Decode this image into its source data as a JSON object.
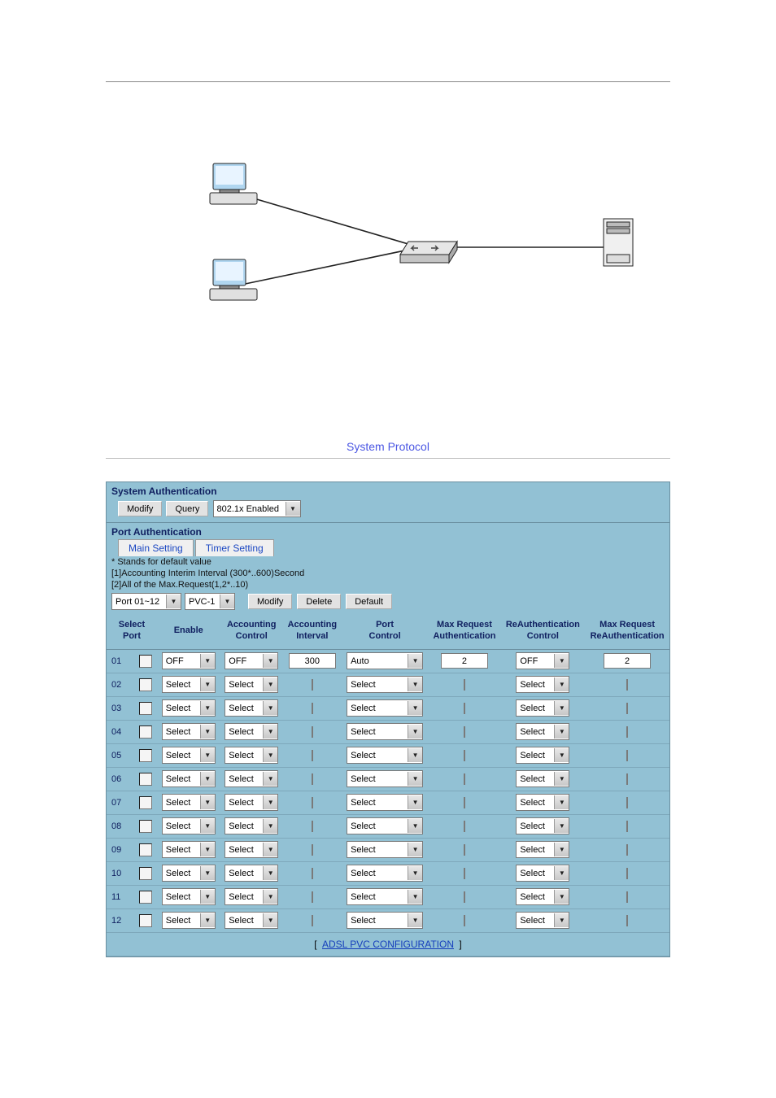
{
  "sectionTitle": "System Protocol",
  "sysAuth": {
    "header": "System Authentication",
    "modify": "Modify",
    "query": "Query",
    "state": "802.1x Enabled"
  },
  "portAuth": {
    "header": "Port Authentication",
    "tab1": "Main Setting",
    "tab2": "Timer Setting",
    "hint1": "* Stands for default value",
    "hint2": "[1]Accounting Interim Interval (300*..600)Second",
    "hint3": "[2]All of the Max.Request(1,2*..10)",
    "portRange": "Port 01~12",
    "pvc": "PVC-1",
    "modify": "Modify",
    "delete": "Delete",
    "default": "Default"
  },
  "cols": {
    "select": "Select<br>Port",
    "enable": "Enable",
    "acctCtrl": "Accounting<br>Control",
    "acctInt": "Accounting<br>Interval",
    "portCtrl": "Port<br>Control",
    "maxReqAuth": "Max Request<br>Authentication",
    "reauthCtrl": "ReAuthentication<br>Control",
    "maxReqReauth": "Max Request<br>ReAuthentication"
  },
  "rows": [
    {
      "port": "01",
      "enable": "OFF",
      "acctCtrl": "OFF",
      "acctInt": "300",
      "portCtrl": "Auto",
      "maxReqAuth": "2",
      "reauthCtrl": "OFF",
      "maxReqReauth": "2"
    },
    {
      "port": "02",
      "enable": "Select",
      "acctCtrl": "Select",
      "acctInt": "",
      "portCtrl": "Select",
      "maxReqAuth": "",
      "reauthCtrl": "Select",
      "maxReqReauth": ""
    },
    {
      "port": "03",
      "enable": "Select",
      "acctCtrl": "Select",
      "acctInt": "",
      "portCtrl": "Select",
      "maxReqAuth": "",
      "reauthCtrl": "Select",
      "maxReqReauth": ""
    },
    {
      "port": "04",
      "enable": "Select",
      "acctCtrl": "Select",
      "acctInt": "",
      "portCtrl": "Select",
      "maxReqAuth": "",
      "reauthCtrl": "Select",
      "maxReqReauth": ""
    },
    {
      "port": "05",
      "enable": "Select",
      "acctCtrl": "Select",
      "acctInt": "",
      "portCtrl": "Select",
      "maxReqAuth": "",
      "reauthCtrl": "Select",
      "maxReqReauth": ""
    },
    {
      "port": "06",
      "enable": "Select",
      "acctCtrl": "Select",
      "acctInt": "",
      "portCtrl": "Select",
      "maxReqAuth": "",
      "reauthCtrl": "Select",
      "maxReqReauth": ""
    },
    {
      "port": "07",
      "enable": "Select",
      "acctCtrl": "Select",
      "acctInt": "",
      "portCtrl": "Select",
      "maxReqAuth": "",
      "reauthCtrl": "Select",
      "maxReqReauth": ""
    },
    {
      "port": "08",
      "enable": "Select",
      "acctCtrl": "Select",
      "acctInt": "",
      "portCtrl": "Select",
      "maxReqAuth": "",
      "reauthCtrl": "Select",
      "maxReqReauth": ""
    },
    {
      "port": "09",
      "enable": "Select",
      "acctCtrl": "Select",
      "acctInt": "",
      "portCtrl": "Select",
      "maxReqAuth": "",
      "reauthCtrl": "Select",
      "maxReqReauth": ""
    },
    {
      "port": "10",
      "enable": "Select",
      "acctCtrl": "Select",
      "acctInt": "",
      "portCtrl": "Select",
      "maxReqAuth": "",
      "reauthCtrl": "Select",
      "maxReqReauth": ""
    },
    {
      "port": "11",
      "enable": "Select",
      "acctCtrl": "Select",
      "acctInt": "",
      "portCtrl": "Select",
      "maxReqAuth": "",
      "reauthCtrl": "Select",
      "maxReqReauth": ""
    },
    {
      "port": "12",
      "enable": "Select",
      "acctCtrl": "Select",
      "acctInt": "",
      "portCtrl": "Select",
      "maxReqAuth": "",
      "reauthCtrl": "Select",
      "maxReqReauth": ""
    }
  ],
  "footerLink": "ADSL PVC CONFIGURATION"
}
